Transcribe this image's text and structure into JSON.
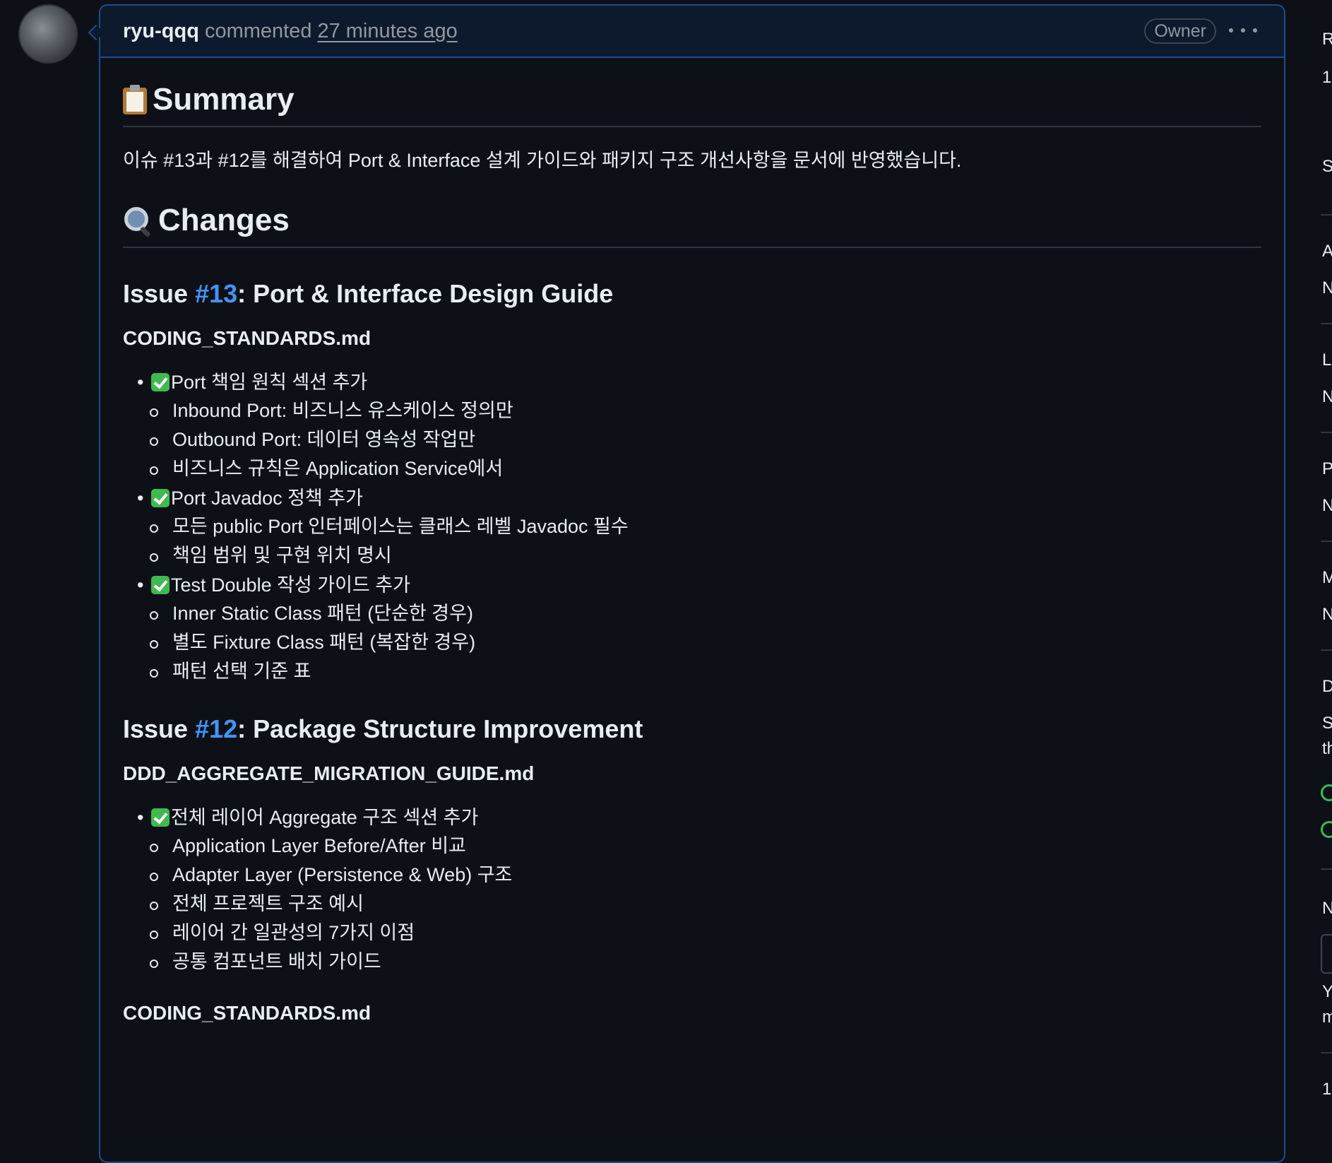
{
  "comment": {
    "author": "ryu-qqq",
    "verb": "commented",
    "time": "27 minutes ago",
    "badge": "Owner"
  },
  "content": {
    "summary_heading": "Summary",
    "summary_text": "이슈 #13과 #12를 해결하여 Port & Interface 설계 가이드와 패키지 구조 개선사항을 문서에 반영했습니다.",
    "changes_heading": "Changes",
    "issue13": {
      "prefix": "Issue ",
      "link": "#13",
      "title": ": Port & Interface Design Guide",
      "file": "CODING_STANDARDS.md",
      "items": [
        {
          "label": "Port 책임 원칙 섹션 추가",
          "subs": [
            "Inbound Port: 비즈니스 유스케이스 정의만",
            "Outbound Port: 데이터 영속성 작업만",
            "비즈니스 규칙은 Application Service에서"
          ]
        },
        {
          "label": "Port Javadoc 정책 추가",
          "subs": [
            "모든 public Port 인터페이스는 클래스 레벨 Javadoc 필수",
            "책임 범위 및 구현 위치 명시"
          ]
        },
        {
          "label": "Test Double 작성 가이드 추가",
          "subs": [
            "Inner Static Class 패턴 (단순한 경우)",
            "별도 Fixture Class 패턴 (복잡한 경우)",
            "패턴 선택 기준 표"
          ]
        }
      ]
    },
    "issue12": {
      "prefix": "Issue ",
      "link": "#12",
      "title": ": Package Structure Improvement",
      "file": "DDD_AGGREGATE_MIGRATION_GUIDE.md",
      "items": [
        {
          "label": "전체 레이어 Aggregate 구조 섹션 추가",
          "subs": [
            "Application Layer Before/After 비교",
            "Adapter Layer (Persistence & Web) 구조",
            "전체 프로젝트 구조 예시",
            "레이어 간 일관성의 7가지 이점",
            "공통 컴포넌트 배치 가이드"
          ]
        }
      ],
      "next_file": "CODING_STANDARDS.md"
    }
  },
  "sidebar": {
    "items": [
      "R",
      "1",
      "S",
      "A",
      "N",
      "L",
      "N",
      "P",
      "N",
      "M",
      "N",
      "D",
      "S",
      "th",
      "N",
      "Y",
      "m",
      "1"
    ]
  },
  "colors": {
    "background": "#0d1117",
    "header_bg": "#0d1a2e",
    "accent_border": "#1f4b8f",
    "link": "#4493f8",
    "muted": "#9198a1",
    "success": "#3fb950"
  },
  "icons": {
    "summary": "clipboard-icon",
    "changes": "magnifier-icon",
    "item": "check-mark-icon",
    "menu": "kebab-icon"
  }
}
